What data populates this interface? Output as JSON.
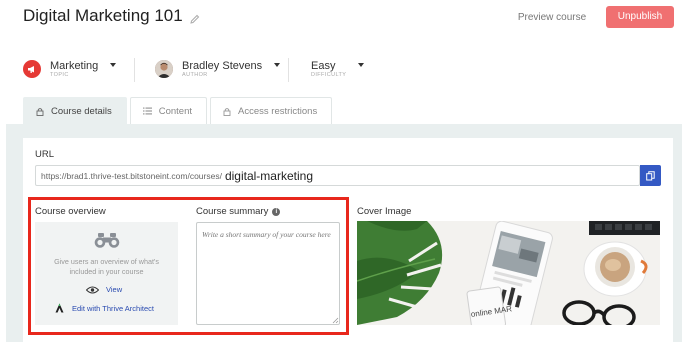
{
  "header": {
    "title": "Digital Marketing 101",
    "preview_label": "Preview course",
    "unpublish_label": "Unpublish"
  },
  "meta": {
    "topic": {
      "name": "Marketing",
      "sub": "TOPIC"
    },
    "author": {
      "name": "Bradley Stevens",
      "sub": "AUTHOR"
    },
    "difficulty": {
      "name": "Easy",
      "sub": "DIFFICULTY"
    }
  },
  "tabs": [
    {
      "label": "Course details",
      "active": true
    },
    {
      "label": "Content",
      "active": false
    },
    {
      "label": "Access restrictions",
      "active": false
    }
  ],
  "url": {
    "label": "URL",
    "prefix": "https://brad1.thrive-test.bitstoneint.com/courses/",
    "slug": "digital-marketing"
  },
  "overview": {
    "label": "Course overview",
    "text": "Give users an overview of what's included in your course",
    "view_label": "View",
    "edit_label": "Edit with Thrive Architect"
  },
  "summary": {
    "label": "Course summary",
    "placeholder": "Write a short summary of your course here"
  },
  "cover": {
    "label": "Cover Image",
    "mug_text": "online MAR"
  },
  "colors": {
    "accent_blue": "#3459c4",
    "unpublish": "#f07071",
    "highlight_frame": "#e8271c"
  }
}
